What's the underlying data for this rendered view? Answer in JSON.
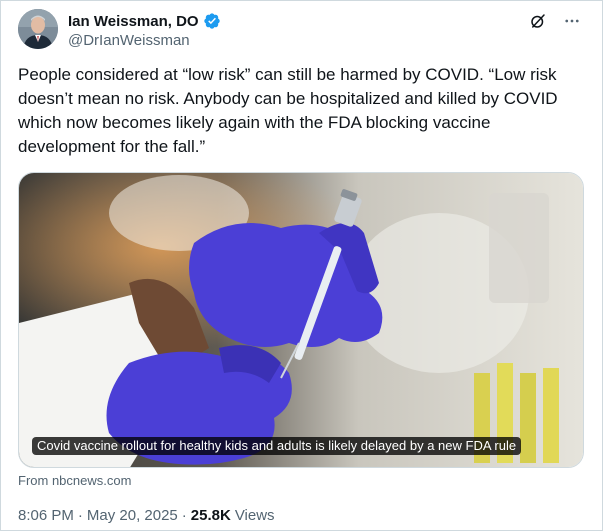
{
  "author": {
    "display_name": "Ian Weissman, DO",
    "handle": "@DrIanWeissman",
    "verified": true
  },
  "icons": {
    "verified": "verified-badge-icon",
    "grok": "grok-icon",
    "more": "more-options-icon"
  },
  "tweet": {
    "text": "People considered at “low risk” can still be harmed by COVID. “Low risk doesn’t mean no risk. Anybody can be hospitalized and killed by COVID which now becomes likely again with the FDA blocking vaccine development for the fall.”"
  },
  "link_card": {
    "caption": "Covid vaccine rollout for healthy kids and adults is likely delayed by a new FDA rule",
    "source": "From nbcnews.com"
  },
  "meta": {
    "time": "8:06 PM",
    "separator": "·",
    "date": "May 20, 2025",
    "views_count": "25.8K",
    "views_label": "Views"
  },
  "colors": {
    "accent": "#1d9bf0",
    "text_primary": "#0f1419",
    "text_secondary": "#536471",
    "glove": "#4b3fd6"
  }
}
